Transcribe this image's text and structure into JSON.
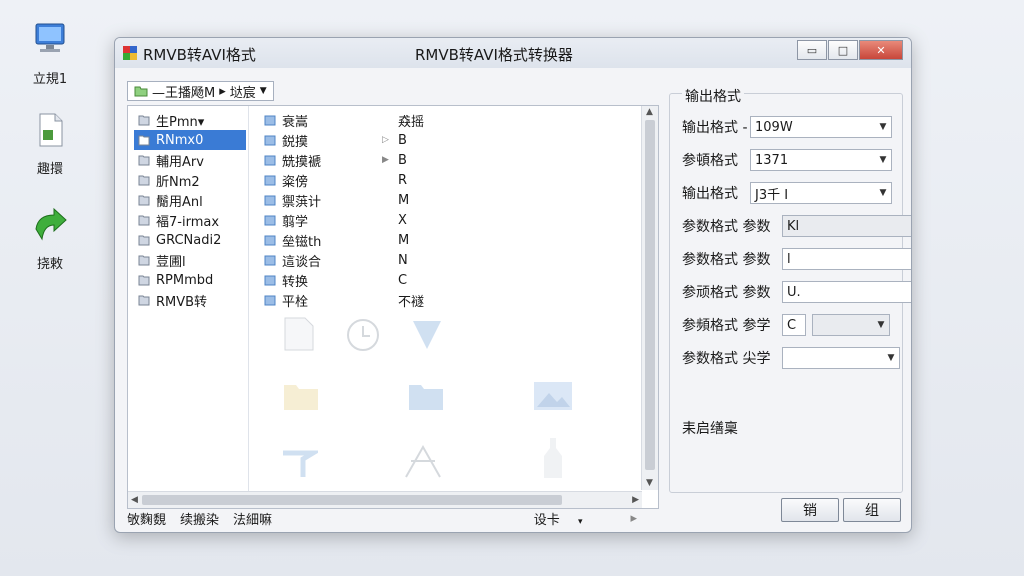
{
  "desktop": {
    "icons": [
      {
        "label": "立規1",
        "icon": "computer-icon"
      },
      {
        "label": "趣擐",
        "icon": "document-icon"
      },
      {
        "label": "挠敕",
        "icon": "green-arrow-icon"
      }
    ]
  },
  "window": {
    "title": "RMVB转AVI格式",
    "center_title": "RMVB转AVI格式转换器",
    "buttons": {
      "minimize": "▭",
      "maximize": "□",
      "close": "✕"
    }
  },
  "toolbar": {
    "breadcrumb": "—王播飏M",
    "separator": "▸",
    "location": "垯宸"
  },
  "browser": {
    "col1": [
      "生Pmn▾",
      "RNmx0",
      "輔用Arv",
      "肵Nm2",
      "鬜用Anl",
      "褔7-irmax",
      "GRCNadi2",
      "荳圃l",
      "RPMmbd",
      "RMVB转"
    ],
    "col2": [
      "衰嵩",
      "鋭摸",
      "兟摸褫",
      "粢傍",
      "禦葓计",
      "翦学",
      "垒镃th",
      "這谈合",
      "转换",
      "平栓"
    ],
    "col3": [
      {
        "arrow": "",
        "text": "猋摇"
      },
      {
        "arrow": "▷",
        "text": "B"
      },
      {
        "arrow": "▶",
        "text": "B"
      },
      {
        "arrow": "",
        "text": "R"
      },
      {
        "arrow": "",
        "text": "M"
      },
      {
        "arrow": "",
        "text": "X"
      },
      {
        "arrow": "",
        "text": "M"
      },
      {
        "arrow": "",
        "text": "N"
      },
      {
        "arrow": "",
        "text": "C"
      },
      {
        "arrow": "",
        "text": "不襚"
      }
    ]
  },
  "status": {
    "items": [
      "敂麴覣",
      "续搬染",
      "法細嘛"
    ],
    "setting": "设卡",
    "setting_arrow": "▾",
    "nav": "▸"
  },
  "panel": {
    "title": "输出格式",
    "rows": [
      {
        "label": "输出格式 -",
        "value": "109W"
      },
      {
        "label": "参頓格式",
        "value": "1371"
      },
      {
        "label": "输出格式",
        "value": "J3千 I"
      },
      {
        "label": "参数格式 参数",
        "value": "Kl"
      },
      {
        "label": "参数格式 参数",
        "value": "l"
      },
      {
        "label": "参顽格式 参数",
        "value": "U."
      },
      {
        "label": "参頻格式 参学",
        "value": "C"
      },
      {
        "label": "参数格式 尖学",
        "value": ""
      }
    ],
    "footer": "耒启缮稟"
  },
  "dialog_buttons": {
    "ok": "销",
    "cancel": "组"
  },
  "colors": {
    "selection": "#3a7bd5",
    "close": "#c8463a"
  }
}
